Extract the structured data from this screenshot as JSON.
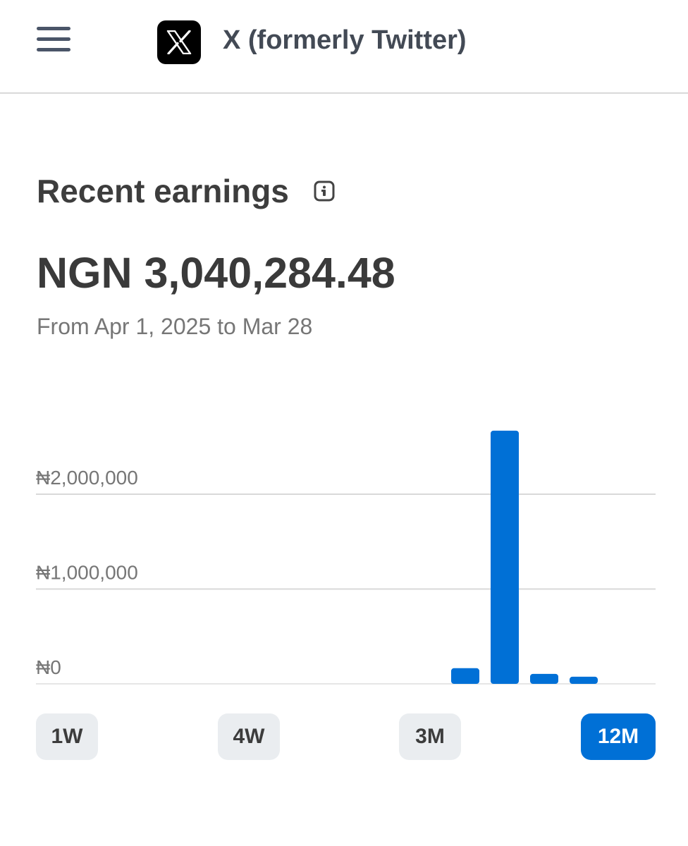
{
  "header": {
    "app_title": "X (formerly Twitter)",
    "menu_icon": "hamburger-menu-icon",
    "logo_icon": "x-logo-icon"
  },
  "earnings": {
    "title": "Recent earnings",
    "info_icon": "info-icon",
    "amount": "NGN 3,040,284.48",
    "date_range": "From Apr 1, 2025 to Mar 28"
  },
  "range_buttons": [
    {
      "label": "1W",
      "active": false
    },
    {
      "label": "4W",
      "active": false
    },
    {
      "label": "3M",
      "active": false
    },
    {
      "label": "12M",
      "active": true
    }
  ],
  "colors": {
    "accent": "#0070d6",
    "button_bg": "#eaedf0",
    "gridline": "#d9d9d9"
  },
  "chart_data": {
    "type": "bar",
    "title": "",
    "xlabel": "",
    "ylabel": "",
    "ylim": [
      0,
      2000000
    ],
    "y_ticks": [
      {
        "value": 2000000,
        "label": "₦2,000,000"
      },
      {
        "value": 1000000,
        "label": "₦1,000,000"
      },
      {
        "value": 0,
        "label": "₦0"
      }
    ],
    "grid": true,
    "bar_color": "#0070d6",
    "values": [
      0,
      0,
      0,
      0,
      0,
      0,
      0,
      0,
      0,
      0,
      0,
      0,
      165000,
      2670000,
      105000,
      75000
    ]
  }
}
